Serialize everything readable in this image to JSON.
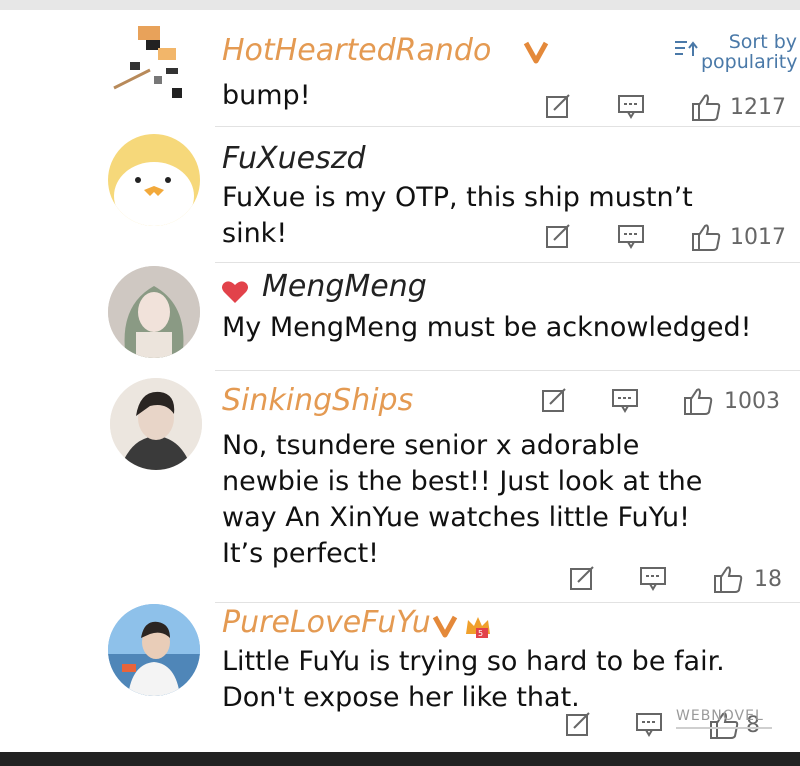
{
  "sort": {
    "label_line1": "Sort by",
    "label_line2": "popularity",
    "icon": "sort-icon"
  },
  "comments": [
    {
      "username": "HotHeartedRando",
      "username_color": "#e49a52",
      "badges": [
        "vip-v-badge"
      ],
      "lines": [
        "bump!"
      ],
      "actions": {
        "reply_icon": "reply-icon",
        "comment_icon": "comment-icon",
        "like_icon": "thumbs-up-icon",
        "likes": "1217"
      }
    },
    {
      "username": "FuXueszd",
      "username_color": "#222222",
      "badges": [],
      "lines": [
        "FuXue is my OTP, this ship mustn’t",
        "sink!"
      ],
      "actions": {
        "likes": "1017"
      }
    },
    {
      "username": "MengMeng",
      "username_color": "#222222",
      "badges": [
        "heart-icon"
      ],
      "lines": [
        "My MengMeng must be acknowledged!"
      ],
      "actions": {}
    },
    {
      "username": "SinkingShips",
      "username_color": "#e49a52",
      "badges": [],
      "lines": [
        "No, tsundere senior x adorable",
        "newbie is the best!! Just look at the",
        "way An XinYue watches little FuYu!",
        "It’s perfect!"
      ],
      "actions": {
        "likes_top": "1003",
        "likes": "18"
      }
    },
    {
      "username": "PureLoveFuYu",
      "username_color": "#e49a52",
      "badges": [
        "vip-v-badge",
        "crown-badge"
      ],
      "lines": [
        "Little FuYu is trying so hard to be fair.",
        "Don't expose her like that."
      ],
      "actions": {
        "likes": "8"
      }
    }
  ],
  "watermark": "WEBNOVEL",
  "colors": {
    "accent": "#e49a52",
    "link": "#4a79a8",
    "icon": "#666666"
  }
}
